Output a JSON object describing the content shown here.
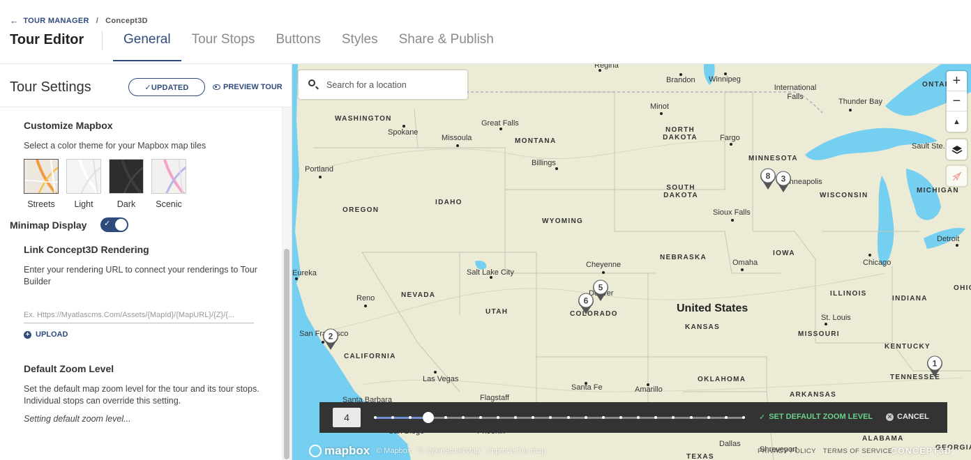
{
  "breadcrumb": {
    "back_label": "TOUR MANAGER",
    "separator": "/",
    "current": "Concept3D"
  },
  "header": {
    "title": "Tour Editor",
    "tabs": [
      {
        "label": "General",
        "active": true
      },
      {
        "label": "Tour Stops",
        "active": false
      },
      {
        "label": "Buttons",
        "active": false
      },
      {
        "label": "Styles",
        "active": false
      },
      {
        "label": "Share & Publish",
        "active": false
      }
    ]
  },
  "panel": {
    "title": "Tour Settings",
    "updated_label": "✓UPDATED",
    "preview_label": "PREVIEW TOUR",
    "mapbox": {
      "title": "Customize Mapbox",
      "description": "Select a color theme for your Mapbox map tiles",
      "themes": [
        {
          "label": "Streets",
          "selected": true
        },
        {
          "label": "Light",
          "selected": false
        },
        {
          "label": "Dark",
          "selected": false
        },
        {
          "label": "Scenic",
          "selected": false
        }
      ]
    },
    "minimap": {
      "label": "Minimap Display",
      "enabled": true
    },
    "rendering": {
      "title": "Link Concept3D Rendering",
      "description": "Enter your rendering URL to connect your renderings to Tour Builder",
      "placeholder": "Ex. Https://Myatlascms.Com/Assets/{MapId}/{MapURL}/{Z}/{...",
      "upload_label": "UPLOAD"
    },
    "zoom": {
      "title": "Default Zoom Level",
      "description": "Set the default map zoom level for the tour and its tour stops. Individual stops can override this setting.",
      "status": "Setting default zoom level..."
    }
  },
  "map": {
    "search_placeholder": "Search for a location",
    "controls": {
      "zoom_in": "+",
      "zoom_out": "−",
      "compass": "▲"
    },
    "country_label": "United States",
    "states": [
      "WASHINGTON",
      "MONTANA",
      "NORTH DAKOTA",
      "MINNESOTA",
      "WISCONSIN",
      "MICHIGAN",
      "ONTARIO",
      "OREGON",
      "IDAHO",
      "WYOMING",
      "SOUTH DAKOTA",
      "NEBRASKA",
      "IOWA",
      "ILLINOIS",
      "INDIANA",
      "OHIO",
      "NEVADA",
      "UTAH",
      "COLORADO",
      "KANSAS",
      "MISSOURI",
      "KENTUCKY",
      "CALIFORNIA",
      "OKLAHOMA",
      "ARKANSAS",
      "TENNESSEE",
      "ALABAMA",
      "GEORGIA",
      "TEXAS"
    ],
    "cities": [
      "Regina",
      "Brandon",
      "Winnipeg",
      "International Falls",
      "Thunder Bay",
      "Minot",
      "Great Falls",
      "Spokane",
      "Missoula",
      "Fargo",
      "Sault Ste. Ma",
      "Portland",
      "Billings",
      "Minneapolis",
      "Sioux Falls",
      "Detroit",
      "Omaha",
      "Chicago",
      "Cheyenne",
      "Salt Lake City",
      "Denver",
      "Reno",
      "San Francisco",
      "St. Louis",
      "Las Vegas",
      "Santa Fe",
      "Amarillo",
      "Santa Barbara",
      "Flagstaff",
      "Phoenix",
      "San Diego",
      "Dallas",
      "Shreveport",
      "Eureka"
    ],
    "markers": [
      "1",
      "2",
      "3",
      "5",
      "6",
      "8"
    ],
    "zoom_bar": {
      "value": "4",
      "level_fraction": 0.143,
      "set_label": "SET DEFAULT ZOOM LEVEL",
      "cancel_label": "CANCEL"
    },
    "attribution": [
      "© Mapbox",
      "© OpenStreetMap",
      "Improve this map"
    ],
    "legal": [
      "PRIVACY POLICY",
      "TERMS OF SERVICE"
    ],
    "mapbox_logo": "mapbox",
    "brand_logo": "CONCEPT3D"
  },
  "colors": {
    "accent": "#2f4b7c",
    "water": "#75cff0",
    "land": "#ecebd6",
    "success": "#6bd28b"
  }
}
